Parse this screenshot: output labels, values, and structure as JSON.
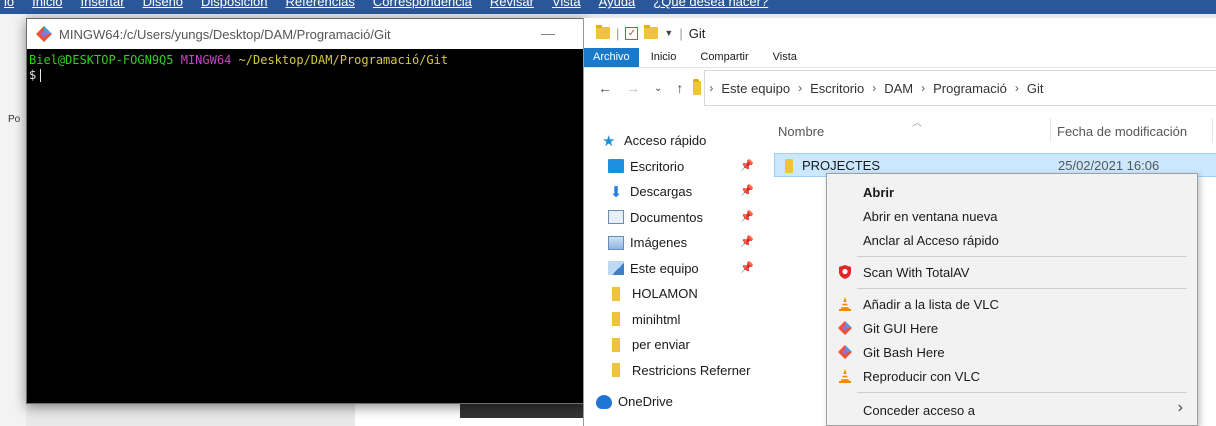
{
  "word": {
    "tabs": [
      "io",
      "Inicio",
      "Insertar",
      "Diseño",
      "Disposición",
      "Referencias",
      "Correspondencia",
      "Revisar",
      "Vista",
      "Ayuda",
      "¿Qué desea hacer?"
    ],
    "left_label": "Po"
  },
  "terminal": {
    "title": "MINGW64:/c/Users/yungs/Desktop/DAM/Programació/Git",
    "minimize": "—",
    "line1_user": "Biel@DESKTOP-FOGN9Q5",
    "line1_env": "MINGW64",
    "line1_path": "~/Desktop/DAM/Programació/Git",
    "line2_prompt": "$"
  },
  "explorer": {
    "title": "Git",
    "ribbon_tabs": [
      "Archivo",
      "Inicio",
      "Compartir",
      "Vista"
    ],
    "breadcrumb": [
      "Este equipo",
      "Escritorio",
      "DAM",
      "Programació",
      "Git"
    ],
    "columns": {
      "name": "Nombre",
      "date": "Fecha de modificación"
    },
    "nav": [
      {
        "label": "Acceso rápido",
        "icon": "star-icon",
        "pinned": false
      },
      {
        "label": "Escritorio",
        "icon": "desktop-icon",
        "pinned": true
      },
      {
        "label": "Descargas",
        "icon": "download-icon",
        "pinned": true
      },
      {
        "label": "Documentos",
        "icon": "documents-icon",
        "pinned": true
      },
      {
        "label": "Imágenes",
        "icon": "images-icon",
        "pinned": true
      },
      {
        "label": "Este equipo",
        "icon": "computer-icon",
        "pinned": true
      },
      {
        "label": "HOLAMON",
        "icon": "folder-icon",
        "pinned": false
      },
      {
        "label": "minihtml",
        "icon": "folder-icon",
        "pinned": false
      },
      {
        "label": "per enviar",
        "icon": "folder-icon",
        "pinned": false
      },
      {
        "label": "Restricions Referner",
        "icon": "folder-icon",
        "pinned": false
      },
      {
        "label": "OneDrive",
        "icon": "cloud-icon",
        "pinned": false
      }
    ],
    "pin_glyph": "📌",
    "selected_row": {
      "name": "PROJECTES",
      "date": "25/02/2021 16:06"
    }
  },
  "context_menu": {
    "items": [
      {
        "label": "Abrir",
        "bold": true,
        "icon": ""
      },
      {
        "label": "Abrir en ventana nueva",
        "bold": false,
        "icon": ""
      },
      {
        "label": "Anclar al Acceso rápido",
        "bold": false,
        "icon": ""
      },
      {
        "label": "Scan With TotalAV",
        "bold": false,
        "icon": "totalav-shield-icon"
      },
      {
        "label": "Añadir a la lista de VLC",
        "bold": false,
        "icon": "vlc-cone-icon"
      },
      {
        "label": "Git GUI Here",
        "bold": false,
        "icon": "git-icon"
      },
      {
        "label": "Git Bash Here",
        "bold": false,
        "icon": "git-icon"
      },
      {
        "label": "Reproducir con VLC",
        "bold": false,
        "icon": "vlc-cone-icon"
      },
      {
        "label": "Conceder acceso a",
        "bold": false,
        "icon": "",
        "submenu": true
      }
    ]
  },
  "colors": {
    "word_ribbon": "#2b579a",
    "terminal_user": "#2ed11b",
    "terminal_env": "#c148c1",
    "terminal_path": "#d8c93a",
    "explorer_active_tab": "#1979ca",
    "selection": "#cce8ff"
  }
}
